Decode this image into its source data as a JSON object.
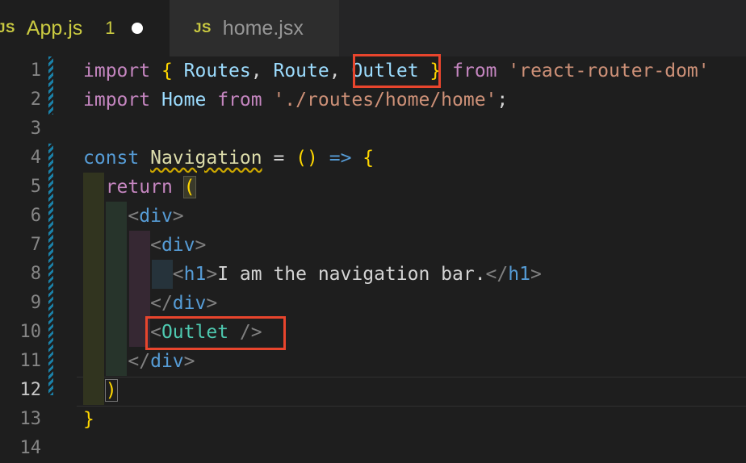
{
  "tabs": [
    {
      "icon": "JS",
      "label": "App.js",
      "problems": "1",
      "active": true
    },
    {
      "icon": "JS",
      "label": "home.jsx",
      "active": false
    }
  ],
  "gutter": {
    "line_numbers": [
      "1",
      "2",
      "3",
      "4",
      "5",
      "6",
      "7",
      "8",
      "9",
      "10",
      "11",
      "12",
      "13",
      "14"
    ],
    "active_line": "12"
  },
  "code": {
    "l1": {
      "import": "import",
      "open": "{",
      "routes": "Routes",
      "comma1": ",",
      "route": "Route",
      "comma2": ",",
      "outlet": "Outlet",
      "close": "}",
      "from": "from",
      "module": "'react-router-dom'"
    },
    "l2": {
      "import": "import",
      "home": "Home",
      "from": "from",
      "path": "'./routes/home/home'",
      "semi": ";"
    },
    "l4": {
      "const": "const",
      "name": "Navigation",
      "eq": "=",
      "parens": "()",
      "arrow": "=>",
      "brace": "{"
    },
    "l5": {
      "return": "return",
      "paren": "("
    },
    "l6": {
      "open": "<",
      "tag": "div",
      "close": ">"
    },
    "l7": {
      "open": "<",
      "tag": "div",
      "close": ">"
    },
    "l8": {
      "open": "<",
      "tag": "h1",
      "close": ">",
      "text": "I am the navigation bar.",
      "endopen": "</",
      "endtag": "h1",
      "endclose": ">"
    },
    "l9": {
      "open": "</",
      "tag": "div",
      "close": ">"
    },
    "l10": {
      "open": "<",
      "tag": "Outlet",
      "selfclose": "/>"
    },
    "l11": {
      "open": "</",
      "tag": "div",
      "close": ">"
    },
    "l12": {
      "paren": ")"
    },
    "l13": {
      "brace": "}"
    }
  },
  "colors": {
    "background": "#1e1e1e",
    "highlight_box": "#e8452d",
    "js_icon": "#cbcb41"
  }
}
